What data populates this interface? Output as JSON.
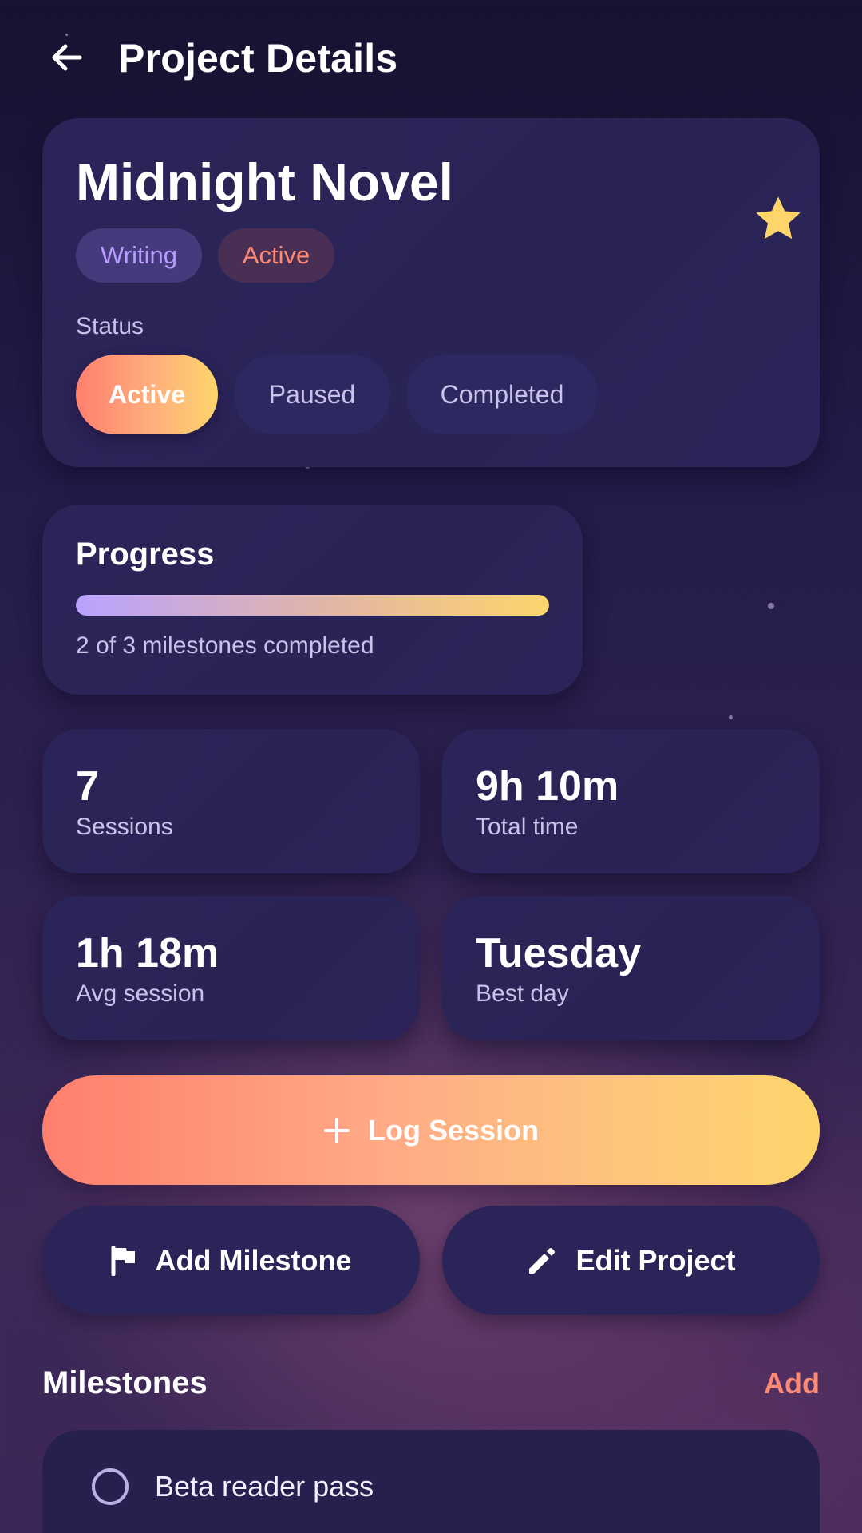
{
  "header": {
    "title": "Project Details",
    "back_icon": "arrow-left-icon"
  },
  "project": {
    "name": "Midnight Novel",
    "favorite": true,
    "favorite_icon": "star-icon",
    "tags": [
      "Writing",
      "Active"
    ],
    "status_label": "Status",
    "status_options": [
      "Active",
      "Paused",
      "Completed"
    ],
    "status_selected": "Active"
  },
  "progress": {
    "title": "Progress",
    "fraction": 1.0,
    "text": "2 of 3 milestones completed"
  },
  "stats": [
    {
      "value": "7",
      "label": "Sessions"
    },
    {
      "value": "9h 10m",
      "label": "Total time"
    },
    {
      "value": "1h 18m",
      "label": "Avg session"
    },
    {
      "value": "Tuesday",
      "label": "Best day"
    }
  ],
  "actions": {
    "log_session": "Log Session",
    "log_icon": "plus-icon",
    "add_milestone": "Add Milestone",
    "add_milestone_icon": "flag-icon",
    "edit_project": "Edit Project",
    "edit_project_icon": "pencil-icon"
  },
  "milestones": {
    "title": "Milestones",
    "add_label": "Add",
    "items": [
      {
        "label": "Beta reader pass",
        "done": false
      }
    ]
  },
  "colors": {
    "accent_coral": "#ff7f6e",
    "accent_gold": "#fdd56b",
    "accent_violet": "#b99cff",
    "card_bg": "#2a2458"
  }
}
